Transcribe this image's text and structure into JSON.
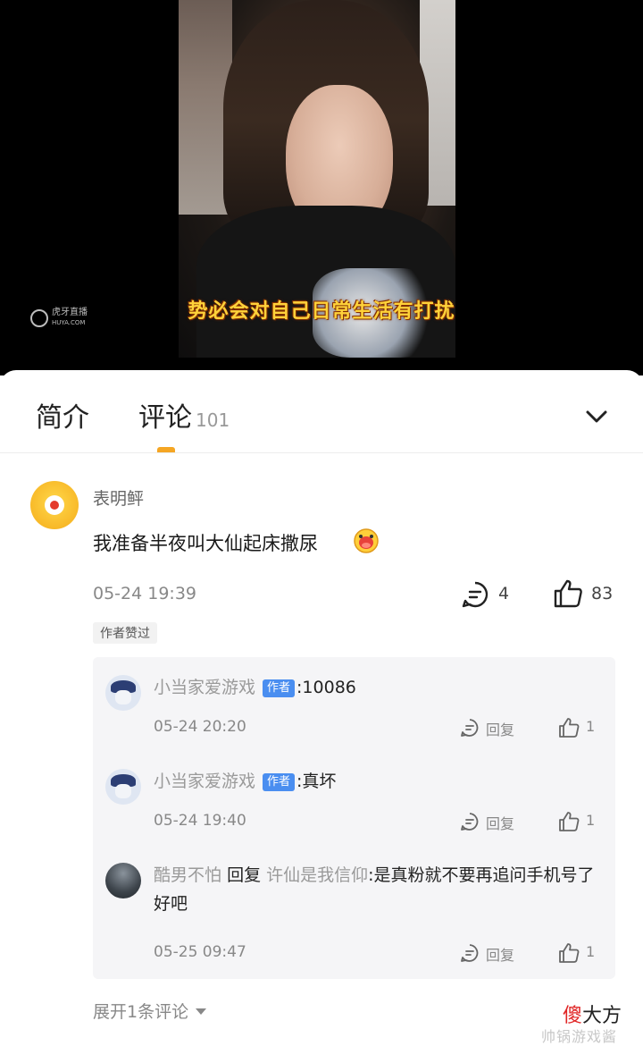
{
  "video": {
    "subtitle": "势必会对自己日常生活有打扰",
    "platform_logo_text": "虎牙直播",
    "platform_logo_sub": "HUYA.COM"
  },
  "tabs": {
    "intro_label": "简介",
    "comments_label": "评论",
    "comments_count": "101",
    "collapse_icon": "chevron-down-icon",
    "accent": "#f5a623"
  },
  "comment": {
    "username": "表明鲆",
    "text": "我准备半夜叫大仙起床撒尿",
    "emoji": "shocked-face-emoji",
    "date": "05-24 19:39",
    "reply_count": "4",
    "like_count": "83",
    "badge": "作者赞过"
  },
  "replies": [
    {
      "name": "小当家爱游戏",
      "tag": "作者",
      "text": ":10086",
      "date": "05-24 20:20",
      "reply_label": "回复",
      "likes": "1"
    },
    {
      "name": "小当家爱游戏",
      "tag": "作者",
      "text": ":真坏",
      "date": "05-24 19:40",
      "reply_label": "回复",
      "likes": "1"
    },
    {
      "name": "酷男不怕",
      "reply_word": "回复",
      "target": "许仙是我信仰",
      "text": ":是真粉就不要再追问手机号了好吧",
      "date": "05-25 09:47",
      "reply_label": "回复",
      "likes": "1"
    }
  ],
  "expand_label": "展开1条评论",
  "watermark": {
    "first": "傻",
    "rest": "大方",
    "sub": "帅锅游戏酱"
  },
  "colors": {
    "author_tag": "#4a8ef0",
    "watermark_red": "#e02424"
  }
}
